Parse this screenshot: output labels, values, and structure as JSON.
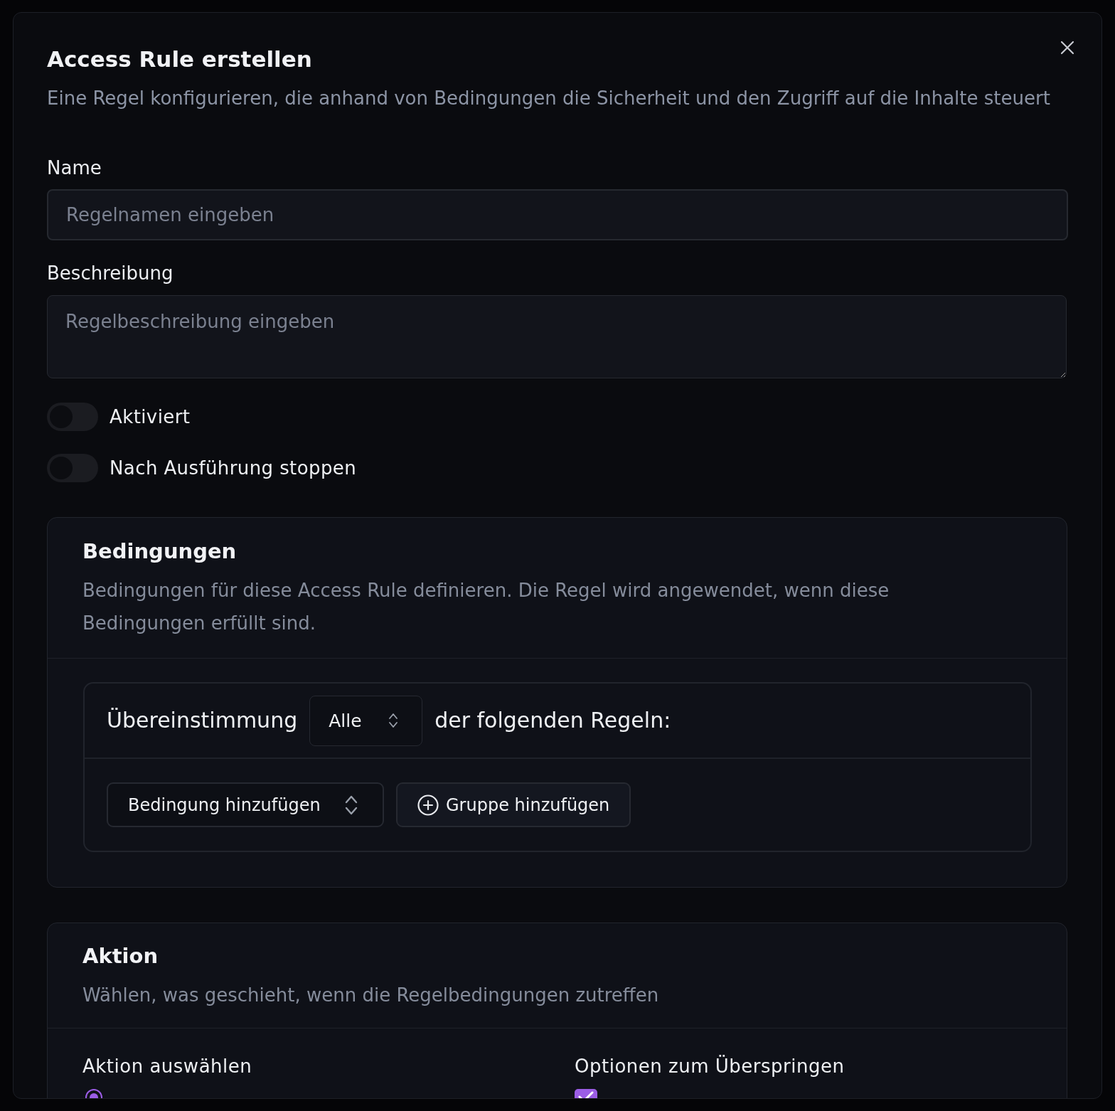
{
  "dialog": {
    "title": "Access Rule erstellen",
    "subtitle": "Eine Regel konfigurieren, die anhand von Bedingungen die Sicherheit und den Zugriff auf die Inhalte steuert"
  },
  "fields": [
    {
      "kind": "input",
      "label": "Name",
      "placeholder": "Regelnamen eingeben"
    },
    {
      "kind": "textarea",
      "label": "Beschreibung",
      "placeholder": "Regelbeschreibung eingeben"
    }
  ],
  "toggles": [
    {
      "label": "Aktiviert",
      "on": false
    },
    {
      "label": "Nach Ausführung stoppen",
      "on": false
    }
  ],
  "conditions": {
    "title": "Bedingungen",
    "description": "Bedingungen für diese Access Rule definieren. Die Regel wird angewendet, wenn diese Bedingungen erfüllt sind.",
    "match_prefix": "Übereinstimmung",
    "match_value": "Alle",
    "match_suffix": "der folgenden Regeln:",
    "buttons": [
      {
        "kind": "select",
        "label": "Bedingung hinzufügen"
      },
      {
        "kind": "add",
        "label": "Gruppe hinzufügen"
      }
    ]
  },
  "action": {
    "title": "Aktion",
    "description": "Wählen, was geschieht, wenn die Regelbedingungen zutreffen",
    "columns": [
      {
        "heading": "Aktion auswählen",
        "kind": "radio",
        "options": [
          {
            "selected": true
          }
        ]
      },
      {
        "heading": "Optionen zum Überspringen",
        "kind": "checkbox",
        "options": [
          {
            "checked": true
          }
        ]
      }
    ]
  }
}
